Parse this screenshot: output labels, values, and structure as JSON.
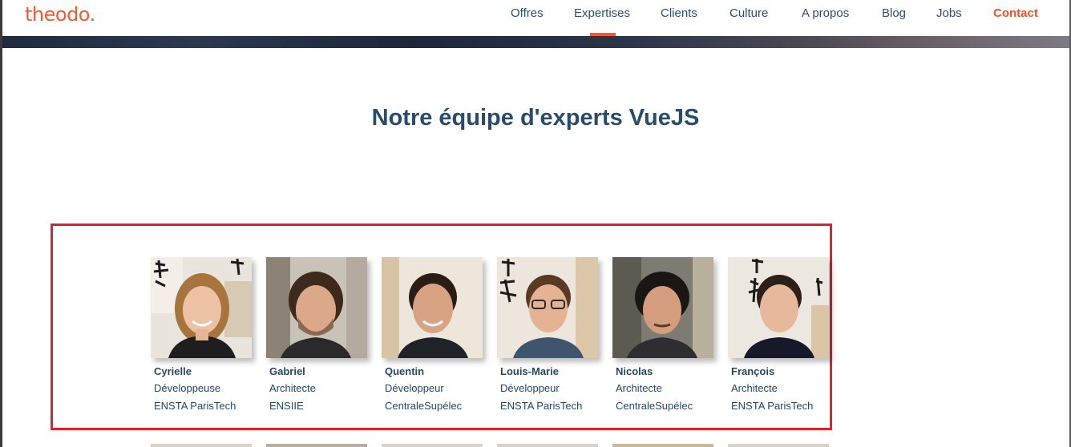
{
  "header": {
    "logo": "theodo.",
    "nav": [
      {
        "label": "Offres"
      },
      {
        "label": "Expertises",
        "active": true
      },
      {
        "label": "Clients"
      },
      {
        "label": "Culture"
      },
      {
        "label": "A propos"
      },
      {
        "label": "Blog"
      },
      {
        "label": "Jobs"
      },
      {
        "label": "Contact"
      }
    ]
  },
  "colors": {
    "accent": "#f25a32",
    "title": "#274c70",
    "highlight": "#e2202c"
  },
  "main": {
    "title": "Notre équipe d'experts VueJS",
    "team": [
      {
        "name": "Cyrielle",
        "role": "Développeuse",
        "school": "ENSTA ParisTech"
      },
      {
        "name": "Gabriel",
        "role": "Architecte",
        "school": "ENSIIE"
      },
      {
        "name": "Quentin",
        "role": "Développeur",
        "school": "CentraleSupélec"
      },
      {
        "name": "Louis-Marie",
        "role": "Développeur",
        "school": "ENSTA ParisTech"
      },
      {
        "name": "Nicolas",
        "role": "Architecte",
        "school": "CentraleSupélec"
      },
      {
        "name": "François",
        "role": "Architecte",
        "school": "ENSTA ParisTech"
      }
    ]
  }
}
